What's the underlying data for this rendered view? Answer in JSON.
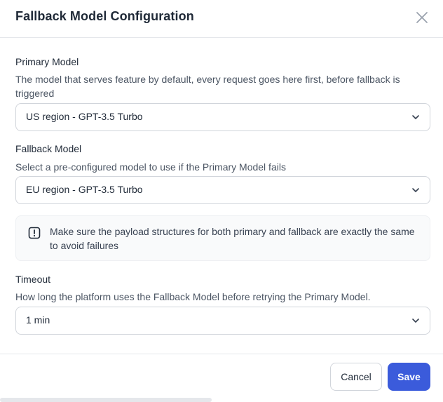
{
  "dialog": {
    "title": "Fallback Model Configuration",
    "close_icon": "close-icon"
  },
  "primary": {
    "label": "Primary Model",
    "description": "The model that serves feature by default, every request goes here first, before fallback is triggered",
    "value": "US region - GPT-3.5 Turbo",
    "chevron_icon": "chevron-down-icon"
  },
  "fallback": {
    "label": "Fallback Model",
    "description": "Select a pre-configured model to use if the Primary Model fails",
    "value": "EU region - GPT-3.5 Turbo",
    "chevron_icon": "chevron-down-icon"
  },
  "notice": {
    "icon": "alert-icon",
    "text": "Make sure the payload structures for both primary and fallback are exactly the same to avoid failures"
  },
  "timeout": {
    "label": "Timeout",
    "description": "How long the platform uses the Fallback Model before retrying the Primary Model.",
    "value": "1 min",
    "chevron_icon": "chevron-down-icon"
  },
  "footer": {
    "cancel_label": "Cancel",
    "save_label": "Save"
  },
  "colors": {
    "primary_button": "#3b5bdb",
    "border": "#d1d5db",
    "notice_background": "#f9fafb"
  }
}
